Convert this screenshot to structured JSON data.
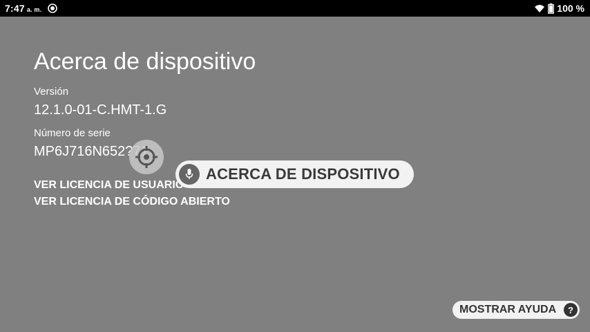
{
  "status_bar": {
    "time": "7:47",
    "ampm": "a. m.",
    "battery": "100 %"
  },
  "page": {
    "title": "Acerca de dispositivo",
    "version_label": "Versión",
    "version_value": "12.1.0-01-C.HMT-1.G",
    "serial_label": "Número de serie",
    "serial_value": "MP6J716N652?71",
    "links": [
      "VER LICENCIA DE USUARIO",
      "VER LICENCIA DE CÓDIGO ABIERTO"
    ]
  },
  "voice_command": {
    "text": "ACERCA DE DISPOSITIVO"
  },
  "help": {
    "label": "MOSTRAR AYUDA",
    "icon_glyph": "?"
  }
}
